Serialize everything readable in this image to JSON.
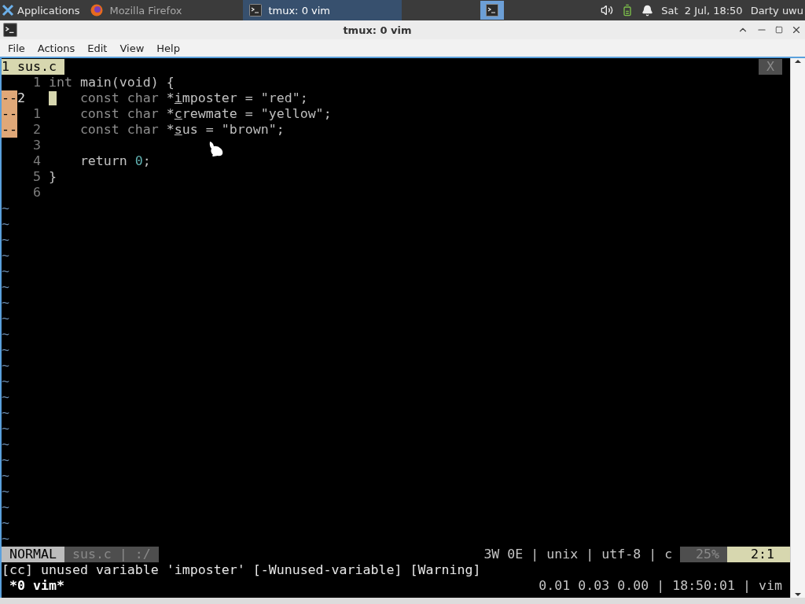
{
  "taskbar": {
    "apps_menu": "Applications",
    "tasks": [
      {
        "title": "Mozilla Firefox",
        "kind": "browser",
        "selected": false
      },
      {
        "title": "tmux: 0 vim",
        "kind": "terminal",
        "selected": true
      }
    ],
    "clock": "Sat  2 Jul, 18:50",
    "user": "Darty uwu"
  },
  "window": {
    "title": "tmux: 0 vim",
    "menu": [
      "File",
      "Actions",
      "Edit",
      "View",
      "Help"
    ]
  },
  "vim": {
    "tabs": [
      {
        "label": "1 sus.c",
        "selected": true
      }
    ],
    "close_label": "X",
    "lines": [
      {
        "number": "1",
        "current": false,
        "segments": [
          {
            "text": "int",
            "kind": "keyword"
          },
          {
            "text": " main(void) {",
            "kind": "plain"
          }
        ]
      },
      {
        "number": "2",
        "current": true,
        "sign": "--",
        "segments": [
          {
            "text": "   const char",
            "kind": "keyword"
          },
          {
            "text": " *",
            "kind": "plain"
          },
          {
            "text": "i",
            "kind": "underlined"
          },
          {
            "text": "mposter = ",
            "kind": "plain"
          },
          {
            "text": "\"red\"",
            "kind": "string"
          },
          {
            "text": ";",
            "kind": "plain"
          }
        ]
      },
      {
        "number": "1",
        "current": false,
        "sign": "--",
        "segments": [
          {
            "text": "    const char",
            "kind": "keyword"
          },
          {
            "text": " *",
            "kind": "plain"
          },
          {
            "text": "c",
            "kind": "underlined"
          },
          {
            "text": "rewmate = ",
            "kind": "plain"
          },
          {
            "text": "\"yellow\"",
            "kind": "string"
          },
          {
            "text": ";",
            "kind": "plain"
          }
        ]
      },
      {
        "number": "2",
        "current": false,
        "sign": "--",
        "segments": [
          {
            "text": "    const char",
            "kind": "keyword"
          },
          {
            "text": " *",
            "kind": "plain"
          },
          {
            "text": "s",
            "kind": "underlined"
          },
          {
            "text": "us = ",
            "kind": "plain"
          },
          {
            "text": "\"brown\"",
            "kind": "string"
          },
          {
            "text": ";",
            "kind": "plain"
          }
        ]
      },
      {
        "number": "3",
        "current": false
      },
      {
        "number": "4",
        "current": false,
        "segments": [
          {
            "text": "    return ",
            "kind": "plain"
          },
          {
            "text": "0",
            "kind": "number"
          },
          {
            "text": ";",
            "kind": "plain"
          }
        ]
      },
      {
        "number": "5",
        "current": false,
        "segments": [
          {
            "text": "}",
            "kind": "plain"
          }
        ]
      },
      {
        "number": "6",
        "current": false
      }
    ],
    "empty_rows": [
      "~",
      "~",
      "~",
      "~",
      "~",
      "~",
      "~",
      "~",
      "~",
      "~",
      "~",
      "~",
      "~",
      "~",
      "~",
      "~",
      "~",
      "~",
      "~",
      "~",
      "~",
      "~"
    ],
    "status": {
      "mode": "NORMAL",
      "file": "sus.c | :/",
      "info": "3W 0E | unix | utf-8 | c",
      "percent": "25%",
      "position": "2:1"
    },
    "message": "[cc] unused variable 'imposter' [-Wunused-variable] [Warning]"
  },
  "tmux": {
    "window": "*0 vim*",
    "status": "0.01 0.03 0.00 | 18:50:01 | vim"
  }
}
